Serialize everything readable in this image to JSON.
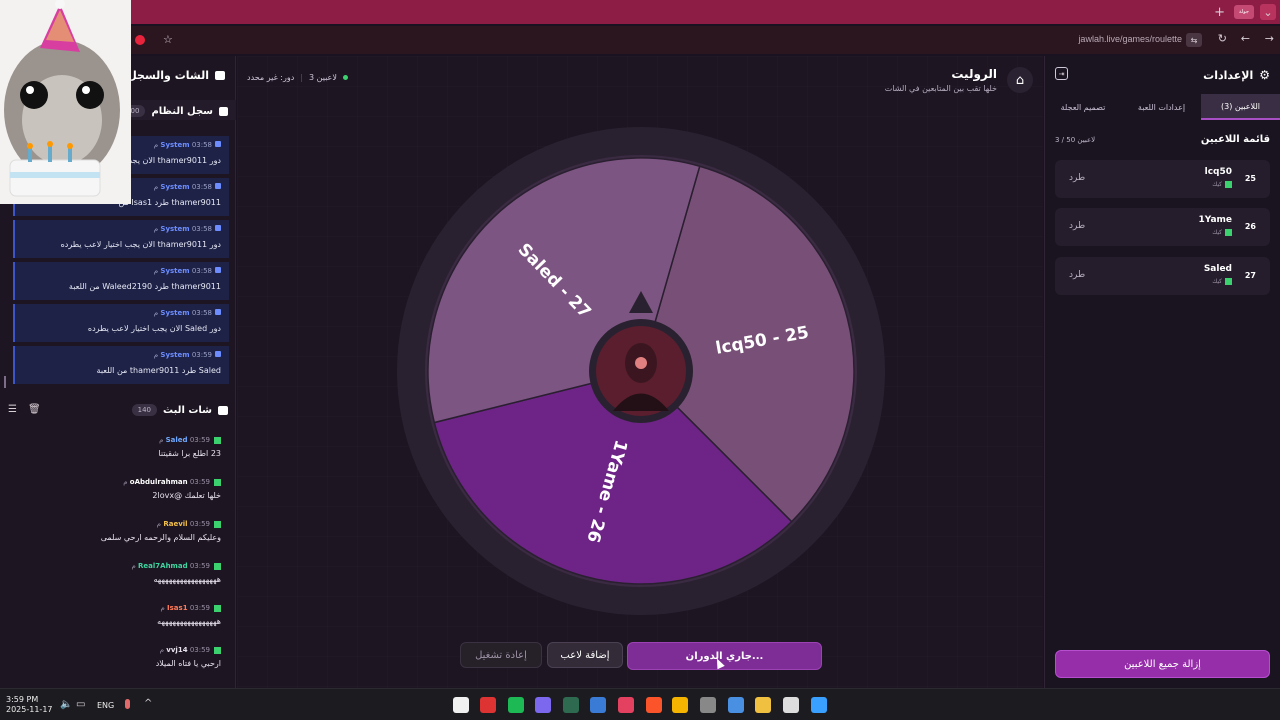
{
  "browser": {
    "url": "jawlah.live/games/roulette",
    "tab_badge": "جولة"
  },
  "left_panel": {
    "title": "الشات والسجل",
    "system_log": {
      "title": "سجل النظام",
      "count": "100",
      "entries": [
        {
          "user": "System",
          "time": "03:58 م",
          "text": "دور thamer9011 الان يجب"
        },
        {
          "user": "System",
          "time": "03:58 م",
          "text": "thamer9011 طرد Isas1 من"
        },
        {
          "user": "System",
          "time": "03:58 م",
          "text": "دور thamer9011 الان يجب اختيار لاعب يطرده"
        },
        {
          "user": "System",
          "time": "03:58 م",
          "text": "thamer9011 طرد Waleed2190 من اللعبة"
        },
        {
          "user": "System",
          "time": "03:58 م",
          "text": "دور Saled الان يجب اختيار لاعب يطرده"
        },
        {
          "user": "System",
          "time": "03:59 م",
          "text": "Saled طرد thamer9011 من اللعبة"
        }
      ]
    },
    "stream_chat": {
      "title": "شات البث",
      "count": "140",
      "messages": [
        {
          "user": "Saled",
          "time": "03:59 م",
          "text": "23 اطلع برا شقيتنا",
          "color": "#6fa8ff"
        },
        {
          "user": "oAbdulrahman",
          "time": "03:59 م",
          "text": "خلها تعلمك @2lovx",
          "color": "#ffffff"
        },
        {
          "user": "Raevil",
          "time": "03:59 م",
          "text": "وعليكم السلام والرحمه ارحي سلمى",
          "color": "#f3c04d"
        },
        {
          "user": "Real7Ahmad",
          "time": "03:59 م",
          "text": "هههههههههههههههههه",
          "color": "#3fd5a0"
        },
        {
          "user": "Isas1",
          "time": "03:59 م",
          "text": "ههههههههههههههههه",
          "color": "#ff7a59"
        },
        {
          "user": "vvj14",
          "time": "03:59 م",
          "text": "ارحبي يا فتاه الميلاد",
          "color": "#e8e2ee"
        }
      ]
    }
  },
  "center": {
    "status": "دور: غير محدد",
    "players_online": "3 لاعبين",
    "title": "الروليت",
    "subtitle": "خلها تقب بين المتابعين في الشات",
    "wheel": {
      "segments": [
        {
          "label": "lcq50 - 25",
          "color": "#785077"
        },
        {
          "label": "1Yame - 26",
          "color": "#6d2486"
        },
        {
          "label": "Saled - 27",
          "color": "#7d5582"
        }
      ]
    },
    "spin_button": "جاري الدوران...",
    "add_player_button": "إضافة لاعب",
    "restart_button": "إعادة تشغيل"
  },
  "right_panel": {
    "title": "الإعدادات",
    "tabs": [
      "اللاعبين (3)",
      "إعدادات اللعبة",
      "تصميم العجلة"
    ],
    "list_title": "قائمة اللاعبين",
    "list_count": "3 / 50 لاعبين",
    "players": [
      {
        "num": "25",
        "name": "lcq50",
        "platform": "كيك",
        "action": "طرد"
      },
      {
        "num": "26",
        "name": "1Yame",
        "platform": "كيك",
        "action": "طرد"
      },
      {
        "num": "27",
        "name": "Saled",
        "platform": "كيك",
        "action": "طرد"
      }
    ],
    "remove_all": "إزالة جميع اللاعبين"
  },
  "taskbar": {
    "time": "3:59 PM",
    "date": "2025-11-17",
    "lang": "ENG"
  }
}
